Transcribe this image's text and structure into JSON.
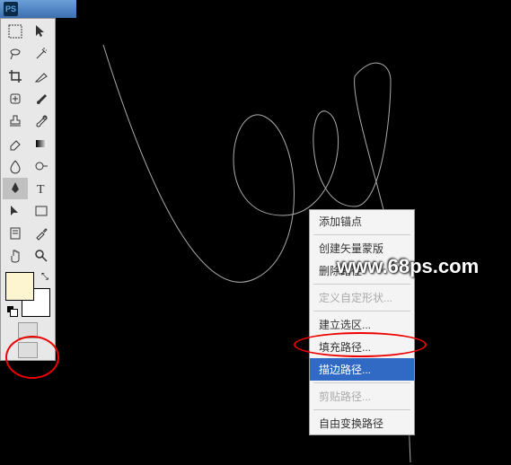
{
  "app": {
    "logo_text": "PS"
  },
  "colors": {
    "foreground": "#fdf5d0",
    "background": "#ffffff"
  },
  "context_menu": {
    "add_anchor": "添加锚点",
    "create_vector_mask": "创建矢量蒙版",
    "delete_path": "删除路径",
    "define_shape": "定义自定形状...",
    "make_selection": "建立选区...",
    "fill_path": "填充路径...",
    "stroke_path": "描边路径...",
    "clip_path": "剪贴路径...",
    "free_transform": "自由变换路径"
  },
  "watermark": "www.68ps.com"
}
